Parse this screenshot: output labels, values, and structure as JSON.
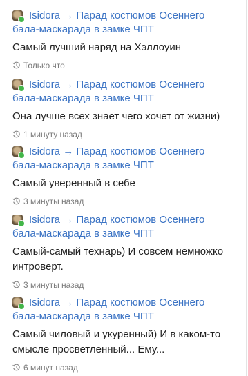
{
  "feed": {
    "entries": [
      {
        "user": "Isidora",
        "arrow": "→",
        "group_line1": "Парад костюмов Осеннего",
        "group_line2": "бала-маскарада в замке ЧПТ",
        "text": "Самый лучший наряд на Хэллоуин",
        "time": "Только что"
      },
      {
        "user": "Isidora",
        "arrow": "→",
        "group_line1": "Парад костюмов Осеннего",
        "group_line2": "бала-маскарада в замке ЧПТ",
        "text": "Она лучше всех знает чего хочет от жизни)",
        "time": "1 минуту назад"
      },
      {
        "user": "Isidora",
        "arrow": "→",
        "group_line1": "Парад костюмов Осеннего",
        "group_line2": "бала-маскарада в замке ЧПТ",
        "text": "Самый уверенный в себе",
        "time": "3 минуты назад"
      },
      {
        "user": "Isidora",
        "arrow": "→",
        "group_line1": "Парад костюмов Осеннего",
        "group_line2": "бала-маскарада в замке ЧПТ",
        "text": "Самый-самый технарь) И совсем немножко интроверт.",
        "time": "3 минуты назад"
      },
      {
        "user": "Isidora",
        "arrow": "→",
        "group_line1": "Парад костюмов Осеннего",
        "group_line2": "бала-маскарада в замке ЧПТ",
        "text": "Самый чиловый и укуренный) И в каком-то смысле просветленный... Ему...",
        "time": "6 минут назад"
      }
    ]
  },
  "icons": {
    "avatar": "user-avatar",
    "online": "online-status-dot",
    "time": "history-clock-icon"
  },
  "colors": {
    "link": "#3b73c4",
    "text": "#222222",
    "meta": "#7a7a7a",
    "online": "#43b649"
  }
}
